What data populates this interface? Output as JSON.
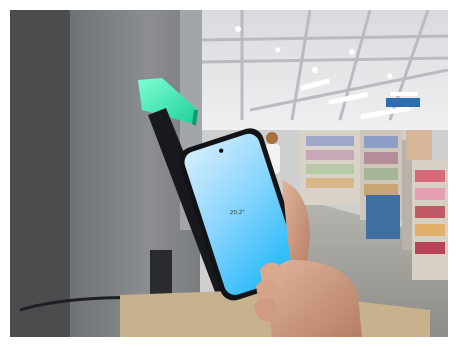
{
  "scene": {
    "phone_screen_text": "20,2°"
  },
  "colors": {
    "beacon_green": "#55f0c0",
    "screen_top": "#cfeaff",
    "screen_bottom": "#3cc2ff",
    "phone_body": "#141518",
    "stand_black": "#1a1b1e",
    "ceiling": "#e3e4e6",
    "floor": "#a8a6a1"
  }
}
